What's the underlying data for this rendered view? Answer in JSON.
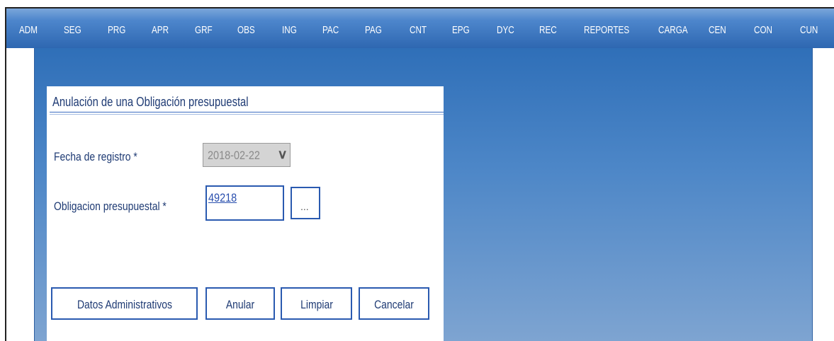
{
  "nav": {
    "items": [
      "ADM",
      "SEG",
      "PRG",
      "APR",
      "GRF",
      "OBS",
      "ING",
      "PAC",
      "PAG",
      "CNT",
      "EPG",
      "DYC",
      "REC",
      "REPORTES",
      "CARGA",
      "CEN",
      "CON",
      "CUN"
    ]
  },
  "form": {
    "title": "Anulación de una Obligación presupuestal",
    "fecha_label": "Fecha de registro *",
    "fecha_value": "2018-02-22",
    "obligacion_label": "Obligacion presupuestal *",
    "obligacion_value": "49218",
    "lookup_label": "..."
  },
  "buttons": {
    "datos": "Datos Administrativos",
    "anular": "Anular",
    "limpiar": "Limpiar",
    "cancelar": "Cancelar"
  },
  "colors": {
    "nav_bg": "#2e67b1",
    "panel_border": "#2a5ab0",
    "label_text": "#1f3b74"
  },
  "icons": {
    "dropdown": "chevron-down-icon"
  }
}
